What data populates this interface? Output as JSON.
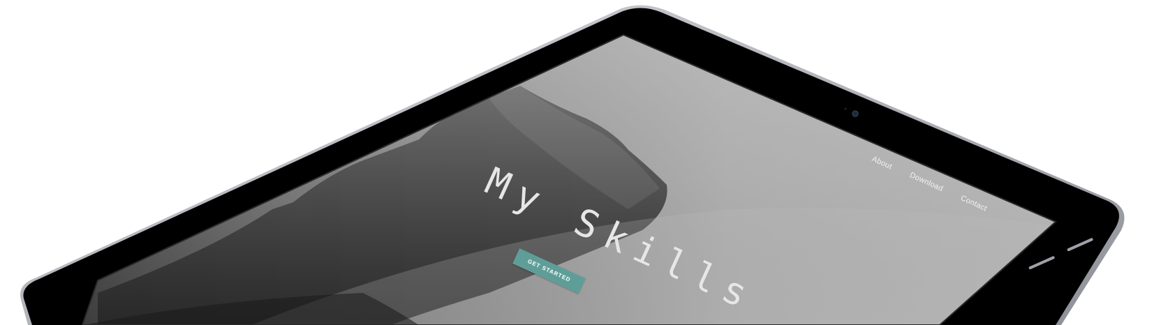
{
  "website": {
    "nav": {
      "items": [
        {
          "label": "About"
        },
        {
          "label": "Download"
        },
        {
          "label": "Contact"
        }
      ]
    },
    "hero": {
      "title": "My Skills",
      "cta_label": "GET STARTED"
    }
  },
  "colors": {
    "device_bezel": "#000000",
    "device_frame": "#b9bcc2",
    "screen_background": "#9a9a9a",
    "cta_background": "#5f9e98",
    "hero_text": "#e6e6e6",
    "page_background": "#ffffff"
  }
}
